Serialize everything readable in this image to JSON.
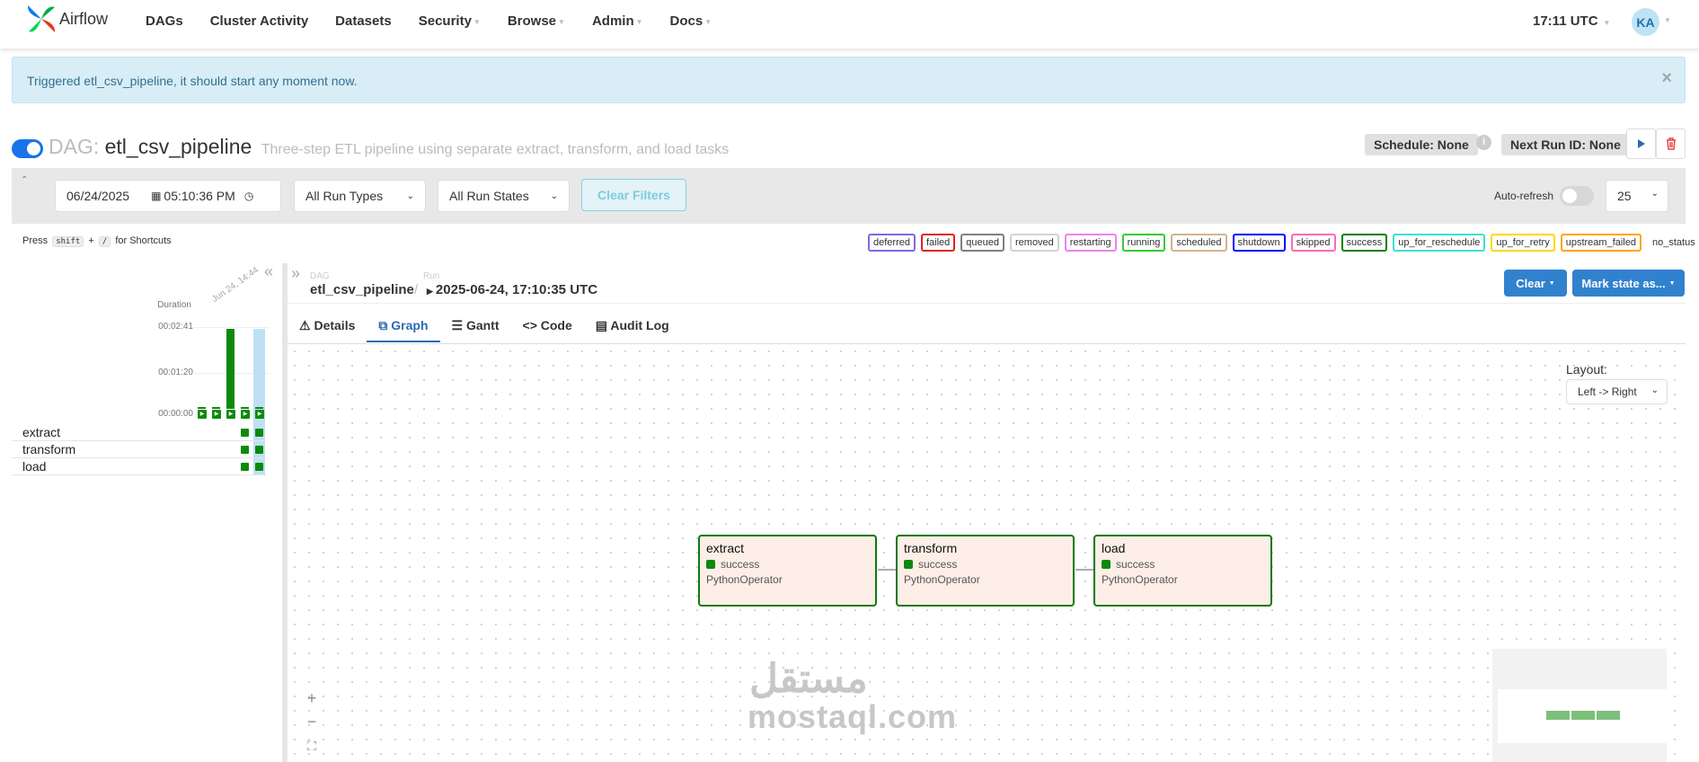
{
  "nav": {
    "brand": "Airflow",
    "menu": [
      {
        "label": "DAGs",
        "caret": false
      },
      {
        "label": "Cluster Activity",
        "caret": false
      },
      {
        "label": "Datasets",
        "caret": false
      },
      {
        "label": "Security",
        "caret": true
      },
      {
        "label": "Browse",
        "caret": true
      },
      {
        "label": "Admin",
        "caret": true
      },
      {
        "label": "Docs",
        "caret": true
      }
    ],
    "time": "17:11 UTC",
    "avatar": "KA"
  },
  "alert": {
    "text": "Triggered etl_csv_pipeline, it should start any moment now.",
    "close": "×"
  },
  "dag": {
    "prefix": "DAG:",
    "name": "etl_csv_pipeline",
    "description": "Three-step ETL pipeline using separate extract, transform, and load tasks",
    "schedule": "Schedule: None",
    "next_run": "Next Run ID: None",
    "paused": false
  },
  "filters": {
    "date": "06/24/2025",
    "time": "05:10:36 PM",
    "run_types": "All Run Types",
    "run_states": "All Run States",
    "clear_filters": "Clear Filters",
    "auto_refresh": "Auto-refresh",
    "page_size": "25"
  },
  "shortcuts": {
    "press": "Press",
    "key1": "shift",
    "plus": "+",
    "key2": "/",
    "suffix": "for Shortcuts"
  },
  "legend": [
    {
      "label": "deferred",
      "color": "#7b68ee"
    },
    {
      "label": "failed",
      "color": "#e02020"
    },
    {
      "label": "queued",
      "color": "#808080"
    },
    {
      "label": "removed",
      "color": "#d3d3d3"
    },
    {
      "label": "restarting",
      "color": "#ee82ee"
    },
    {
      "label": "running",
      "color": "#32cd32"
    },
    {
      "label": "scheduled",
      "color": "#d2b48c"
    },
    {
      "label": "shutdown",
      "color": "#0000ff"
    },
    {
      "label": "skipped",
      "color": "#ff69b4"
    },
    {
      "label": "success",
      "color": "#008000"
    },
    {
      "label": "up_for_reschedule",
      "color": "#40e0d0"
    },
    {
      "label": "up_for_retry",
      "color": "#ffd700"
    },
    {
      "label": "upstream_failed",
      "color": "#ffa500"
    },
    {
      "label": "no_status",
      "color": "#ffffff"
    }
  ],
  "grid": {
    "duration_label": "Duration",
    "ticks": [
      "00:02:41",
      "00:01:20",
      "00:00:00"
    ],
    "date_label": "Jun 24, 14:44",
    "runs_duration_fraction": [
      0.02,
      0.02,
      1.0,
      0.02,
      0.02
    ],
    "tasks": [
      "extract",
      "transform",
      "load"
    ]
  },
  "breadcrumb": {
    "dag_small": "DAG",
    "dag": "etl_csv_pipeline",
    "sep": "/",
    "run_small": "Run",
    "run": "2025-06-24, 17:10:35 UTC"
  },
  "actions": {
    "clear": "Clear",
    "mark": "Mark state as..."
  },
  "tabs": [
    {
      "label": "Details",
      "icon": "warning-icon"
    },
    {
      "label": "Graph",
      "icon": "graph-icon"
    },
    {
      "label": "Gantt",
      "icon": "gantt-icon"
    },
    {
      "label": "Code",
      "icon": "code-icon"
    },
    {
      "label": "Audit Log",
      "icon": "document-icon"
    }
  ],
  "graph": {
    "layout_label": "Layout:",
    "layout_value": "Left -> Right",
    "nodes": [
      {
        "name": "extract",
        "state": "success",
        "operator": "PythonOperator"
      },
      {
        "name": "transform",
        "state": "success",
        "operator": "PythonOperator"
      },
      {
        "name": "load",
        "state": "success",
        "operator": "PythonOperator"
      }
    ]
  },
  "watermark": {
    "arabic": "مستقل",
    "latin": "mostaql.com"
  }
}
